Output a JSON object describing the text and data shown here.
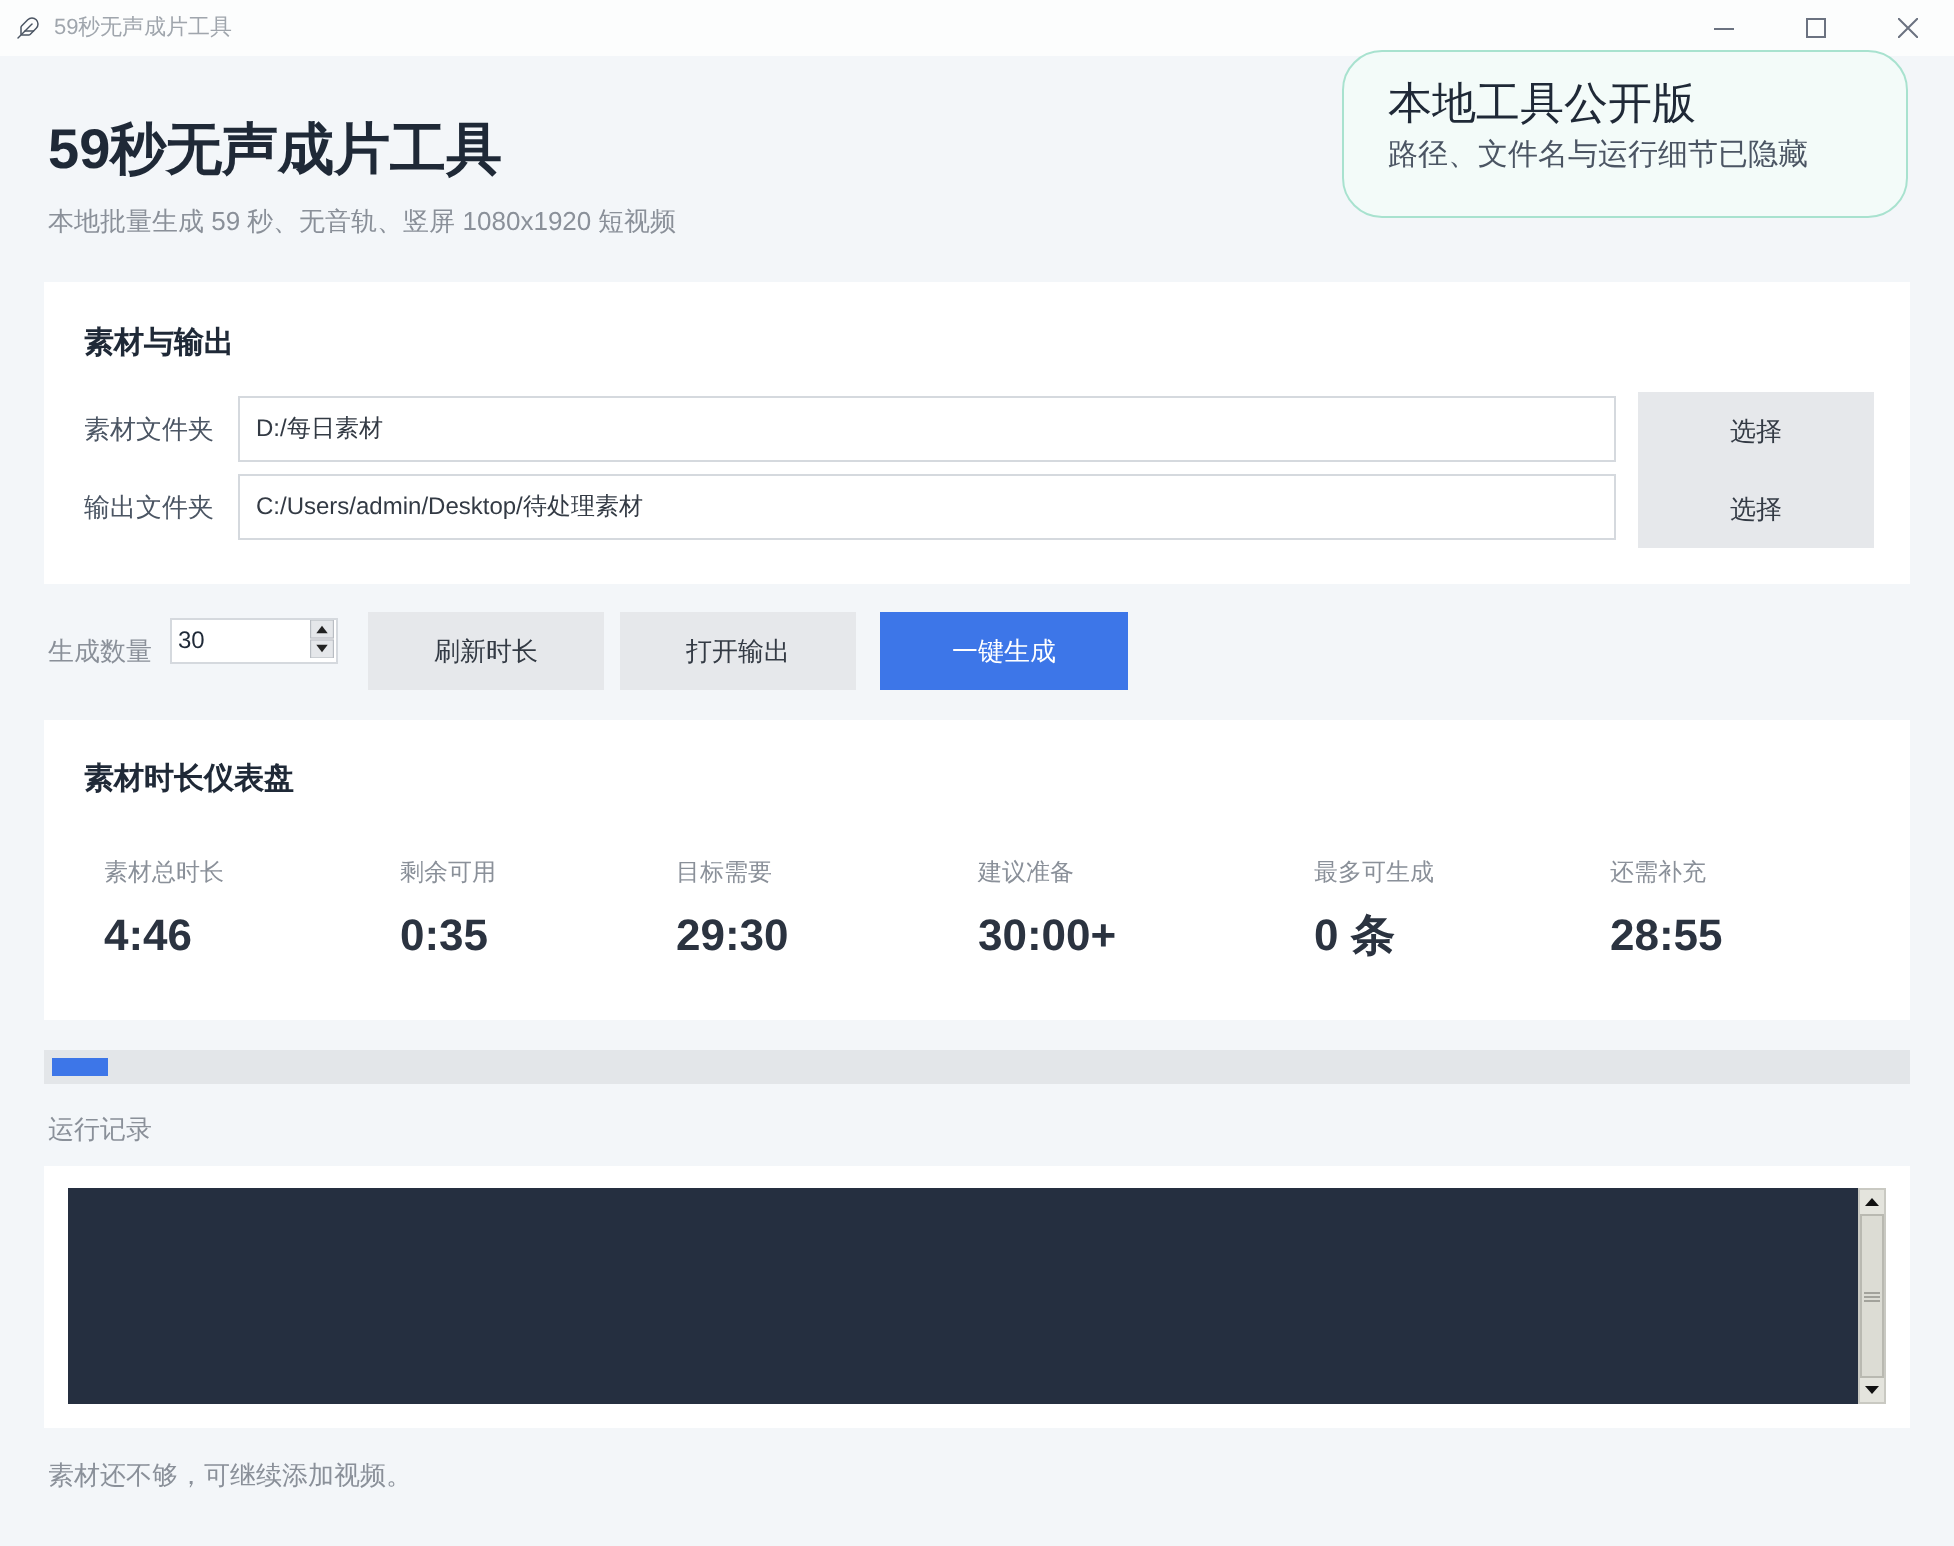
{
  "window": {
    "title": "59秒无声成片工具"
  },
  "header": {
    "title": "59秒无声成片工具",
    "subtitle": "本地批量生成 59 秒、无音轨、竖屏 1080x1920 短视频"
  },
  "notice": {
    "title": "本地工具公开版",
    "text": "路径、文件名与运行细节已隐藏"
  },
  "io_panel": {
    "title": "素材与输出",
    "rows": [
      {
        "label": "素材文件夹",
        "value": "D:/每日素材",
        "button": "选择"
      },
      {
        "label": "输出文件夹",
        "value": "C:/Users/admin/Desktop/待处理素材",
        "button": "选择"
      }
    ]
  },
  "controls": {
    "count_label": "生成数量",
    "count_value": "30",
    "buttons": [
      {
        "label": "刷新时长",
        "kind": "secondary"
      },
      {
        "label": "打开输出",
        "kind": "secondary"
      },
      {
        "label": "一键生成",
        "kind": "primary"
      }
    ]
  },
  "dashboard": {
    "title": "素材时长仪表盘",
    "stats": [
      {
        "label": "素材总时长",
        "value": "4:46"
      },
      {
        "label": "剩余可用",
        "value": "0:35"
      },
      {
        "label": "目标需要",
        "value": "29:30"
      },
      {
        "label": "建议准备",
        "value": "30:00+"
      },
      {
        "label": "最多可生成",
        "value": "0 条"
      },
      {
        "label": "还需补充",
        "value": "28:55"
      }
    ]
  },
  "progress": {
    "level": 0.03
  },
  "log": {
    "label": "运行记录"
  },
  "status_bar": {
    "text": "素材还不够，可继续添加视频。"
  }
}
